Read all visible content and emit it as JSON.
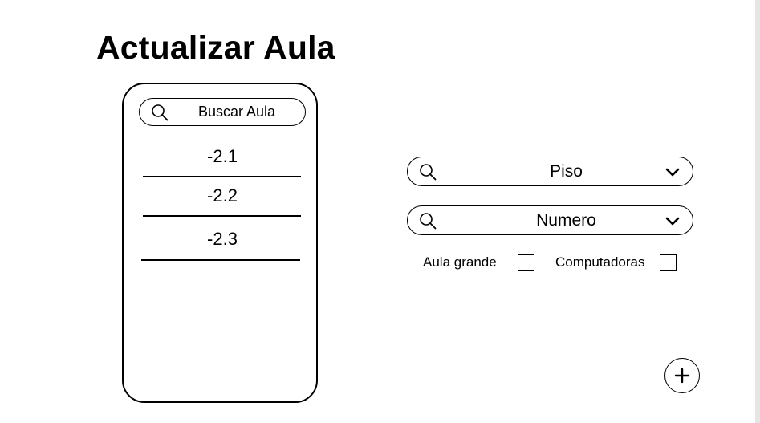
{
  "page": {
    "title": "Actualizar Aula"
  },
  "aula_list": {
    "search": {
      "placeholder": "Buscar Aula",
      "icon": "search-icon"
    },
    "items": [
      {
        "label": "-2.1"
      },
      {
        "label": "-2.2"
      },
      {
        "label": "-2.3"
      }
    ]
  },
  "filters": {
    "piso": {
      "label": "Piso",
      "icon": "search-icon",
      "dropdown_icon": "chevron-down-icon"
    },
    "numero": {
      "label": "Numero",
      "icon": "search-icon",
      "dropdown_icon": "chevron-down-icon"
    },
    "checkboxes": [
      {
        "label": "Aula grande",
        "checked": false
      },
      {
        "label": "Computadoras",
        "checked": false
      }
    ]
  },
  "actions": {
    "add_icon": "plus-icon"
  }
}
